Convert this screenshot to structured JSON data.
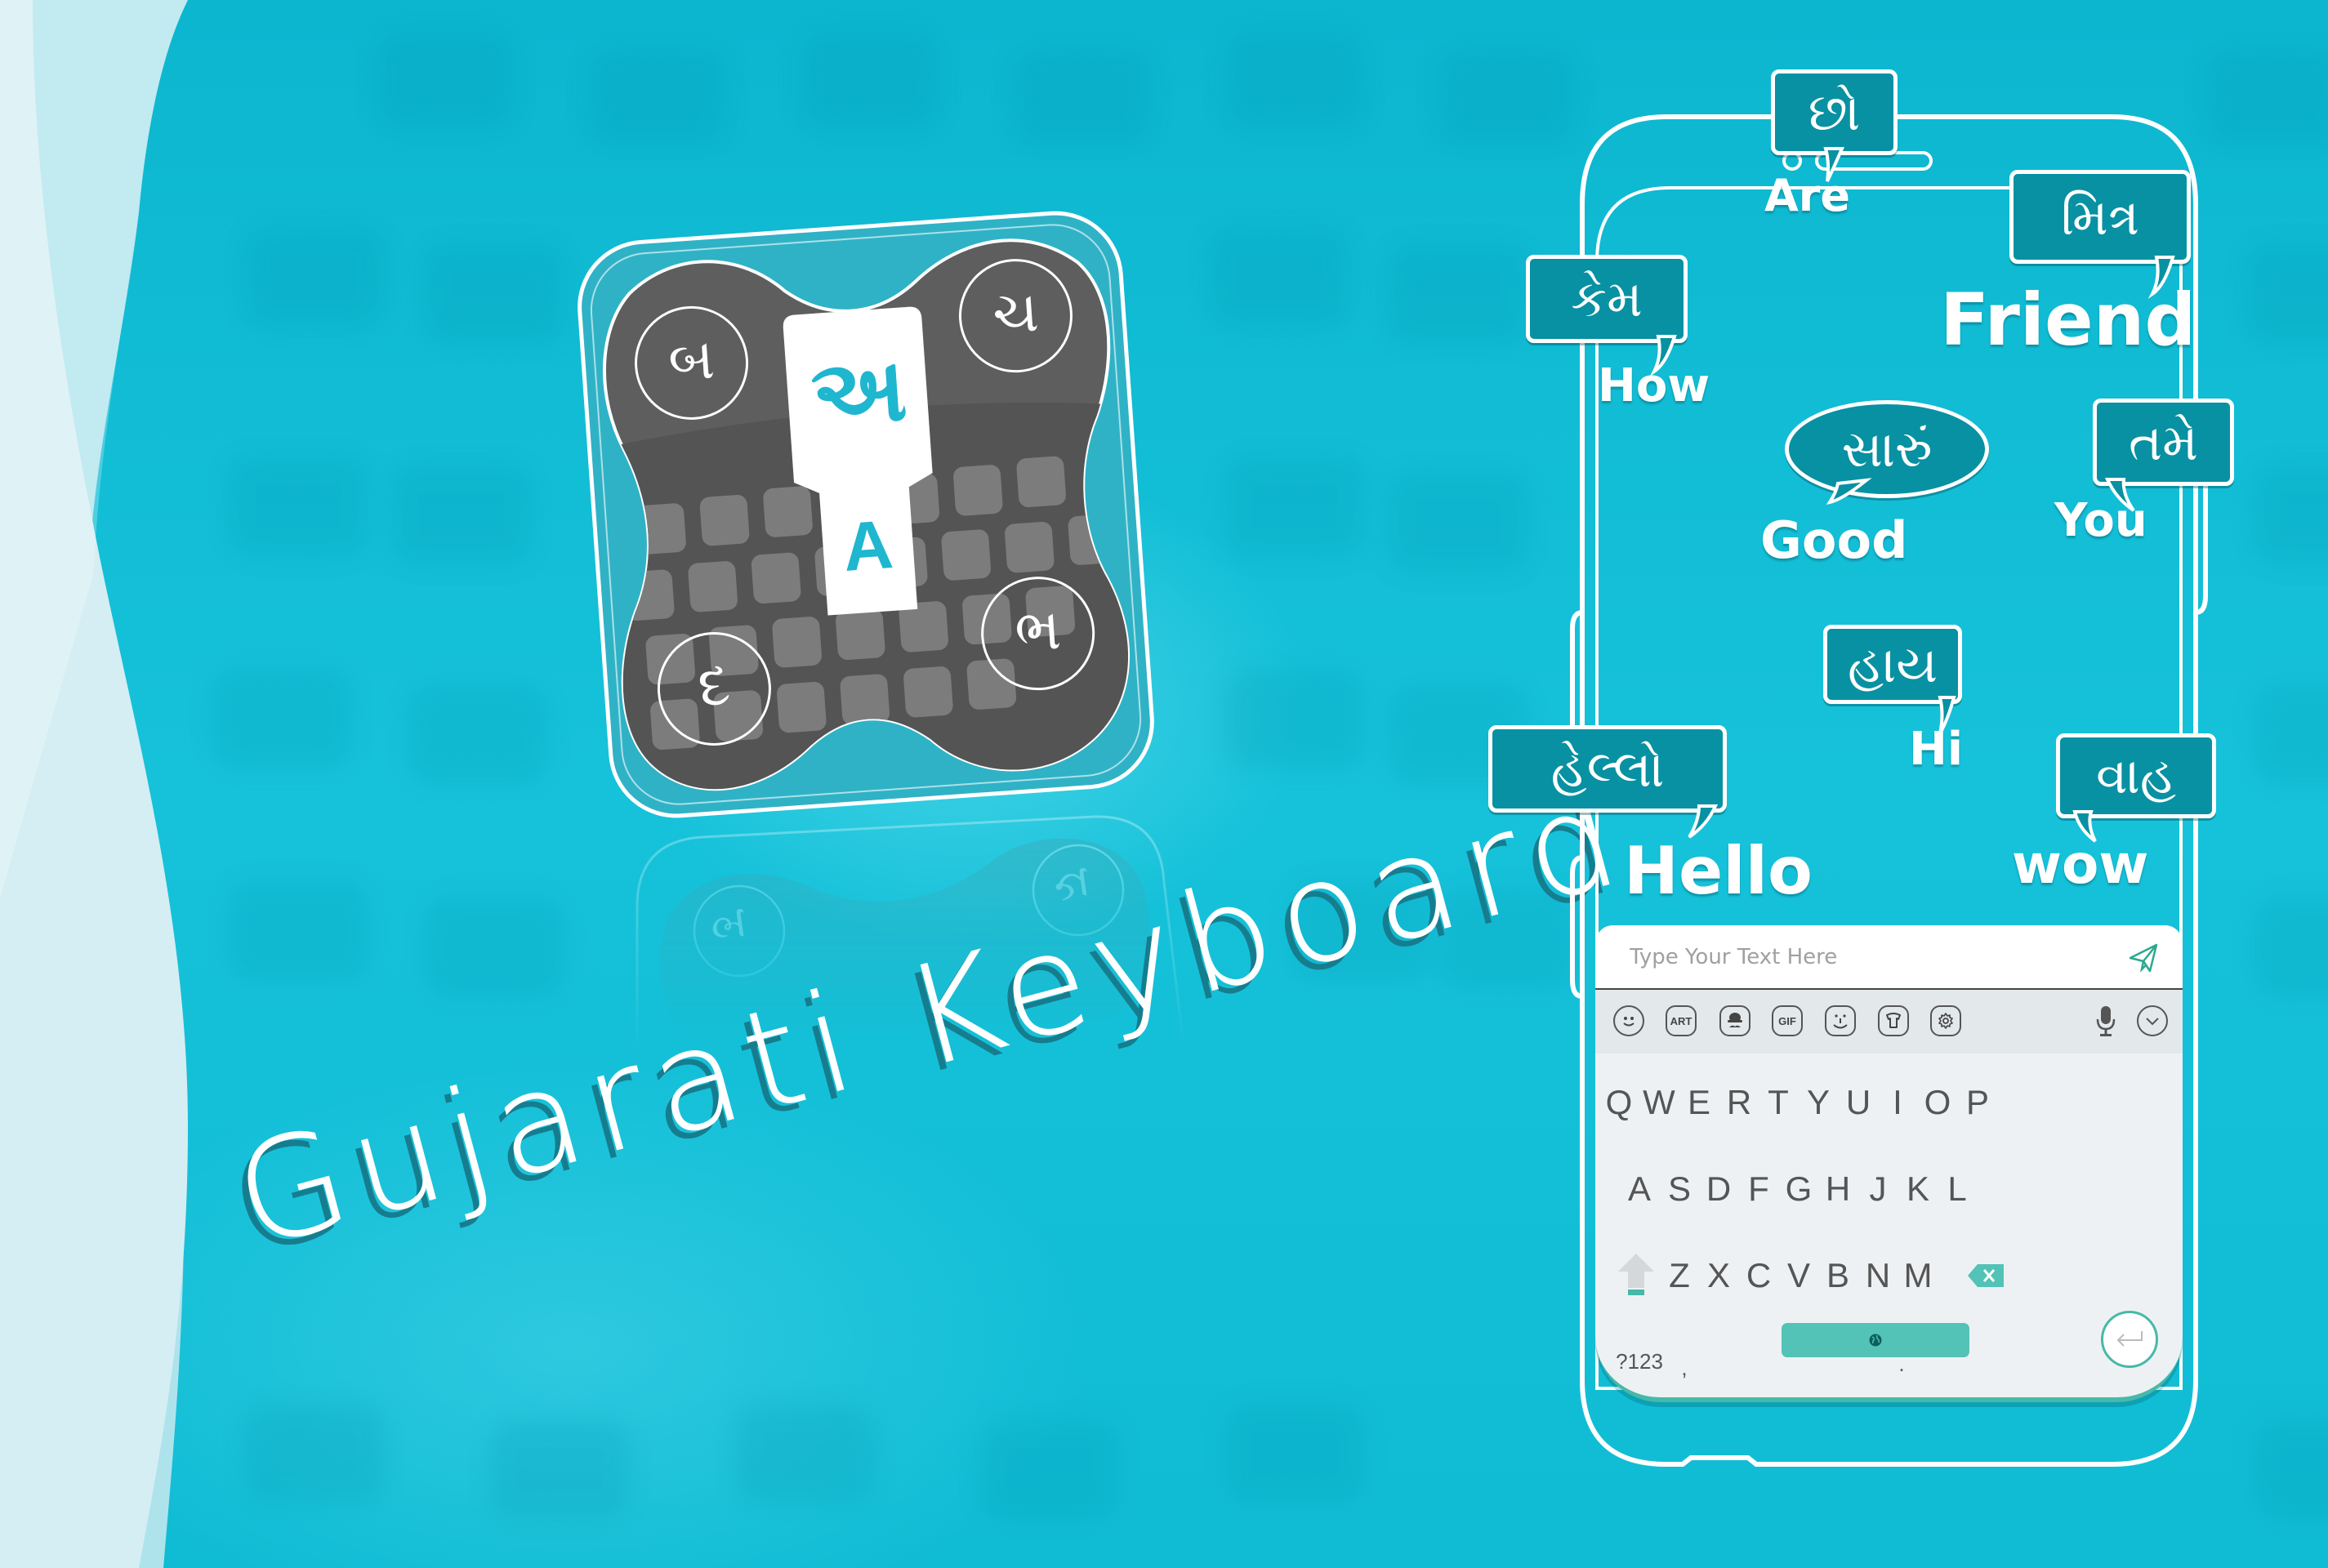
{
  "title": "Gujarati Keyboard",
  "colors": {
    "background": "#12bfd6",
    "bubble": "#0891a2",
    "accent": "#52c3b6",
    "icon_body": "#5f5f5f",
    "icon_key_letter": "#1fb6cf"
  },
  "app_icon": {
    "main_key_gujarati": "અ",
    "main_key_latin": "A",
    "corner_letters": [
      "બ",
      "ચ",
      "દ",
      "ભ"
    ]
  },
  "reflection": {
    "corner_letters": [
      "બ",
      "ચ"
    ]
  },
  "bubbles": [
    {
      "gujarati": "છો",
      "english": "Are"
    },
    {
      "gujarati": "મિત્ર",
      "english": "Friend"
    },
    {
      "gujarati": "કેમ",
      "english": "How"
    },
    {
      "gujarati": "સારું",
      "english": "Good"
    },
    {
      "gujarati": "તમે",
      "english": "You"
    },
    {
      "gujarati": "હાય",
      "english": "Hi"
    },
    {
      "gujarati": "હેલ્લો",
      "english": "Hello"
    },
    {
      "gujarati": "વાહ",
      "english": "wow"
    }
  ],
  "keyboard": {
    "input_placeholder": "Type Your Text Here",
    "input_value": "",
    "toolbar": [
      {
        "name": "emoji-icon",
        "label": ""
      },
      {
        "name": "art-icon",
        "label": "ART"
      },
      {
        "name": "sticker-icon",
        "label": ""
      },
      {
        "name": "gif-icon",
        "label": "GIF"
      },
      {
        "name": "emoticon-icon",
        "label": ""
      },
      {
        "name": "theme-icon",
        "label": ""
      },
      {
        "name": "settings-icon",
        "label": ""
      },
      {
        "name": "microphone-icon",
        "label": ""
      },
      {
        "name": "collapse-icon",
        "label": ""
      }
    ],
    "row1": [
      "Q",
      "W",
      "E",
      "R",
      "T",
      "Y",
      "U",
      "I",
      "O",
      "P"
    ],
    "row2": [
      "A",
      "S",
      "D",
      "F",
      "G",
      "H",
      "J",
      "K",
      "L"
    ],
    "row3": [
      "Z",
      "X",
      "C",
      "V",
      "B",
      "N",
      "M"
    ],
    "symbols_key": "?123",
    "comma_key": ",",
    "period_key": "."
  }
}
